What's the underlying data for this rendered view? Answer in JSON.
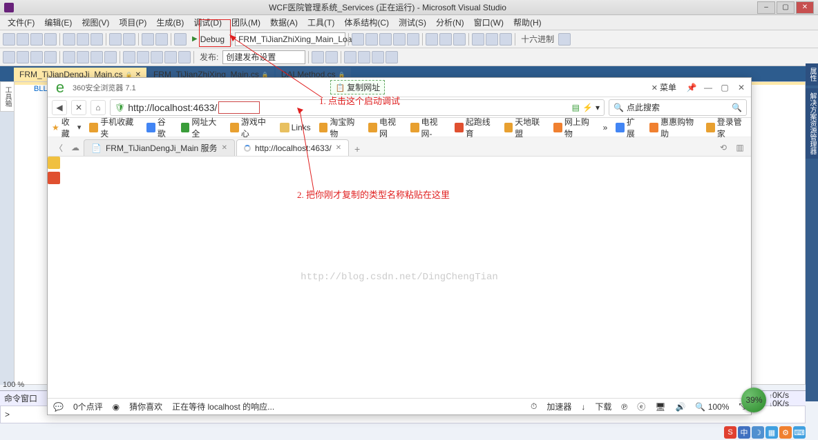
{
  "vs": {
    "title": "WCF医院管理系统_Services (正在运行) - Microsoft Visual Studio",
    "menus": [
      "文件(F)",
      "编辑(E)",
      "视图(V)",
      "项目(P)",
      "生成(B)",
      "调试(D)",
      "团队(M)",
      "数据(A)",
      "工具(T)",
      "体系结构(C)",
      "测试(S)",
      "分析(N)",
      "窗口(W)",
      "帮助(H)"
    ],
    "debug_label": "Debug",
    "combo": "FRM_TiJianZhiXing_Main_Load",
    "publish_label": "发布:",
    "publish_value": "创建发布设置",
    "hex_label": "十六进制",
    "tabs": [
      {
        "label": "FRM_TiJianDengJi_Main.cs",
        "active": true
      },
      {
        "label": "FRM_TiJianZhiXing_Main.cs",
        "active": false
      },
      {
        "label": "DALMethod.cs",
        "active": false
      }
    ],
    "left_tool": "工具箱",
    "right_panel1": "属性",
    "right_panel2": "解决方案资源管理器",
    "blu": "BLL",
    "zoom": "100 %",
    "cmdwin": "命令窗口",
    "cmdprompt": ">"
  },
  "browser": {
    "name": "360安全浏览器 7.1",
    "copy_btn": "复制网址",
    "menu_label": "菜单",
    "url": "http://localhost:4633/",
    "search_placeholder": "点此搜索",
    "fav_label": "收藏",
    "bookmarks": [
      "手机收藏夹",
      "谷歌",
      "网址大全",
      "游戏中心",
      "Links",
      "淘宝购物",
      "电视网",
      "电视网-",
      "起跑线育",
      "天地联盟",
      "网上购物"
    ],
    "right_bookmarks": [
      "扩展",
      "惠惠购物助",
      "登录管家"
    ],
    "tab1": "FRM_TiJianDengJi_Main 服务",
    "tab2": "http://localhost:4633/",
    "watermark": "http://blog.csdn.net/DingChengTian",
    "status_comments": "0个点评",
    "status_like": "猜你喜欢",
    "status_wait": "正在等待 localhost 的响应...",
    "status_accel": "加速器",
    "status_dl": "下载",
    "speed_pct": "39%",
    "kbs": "0K/s"
  },
  "ann": {
    "a1": "1. 点击这个启动调试",
    "a2": "2. 把你刚才复制的类型名称粘贴在这里"
  },
  "ime": {
    "cn": "中"
  }
}
